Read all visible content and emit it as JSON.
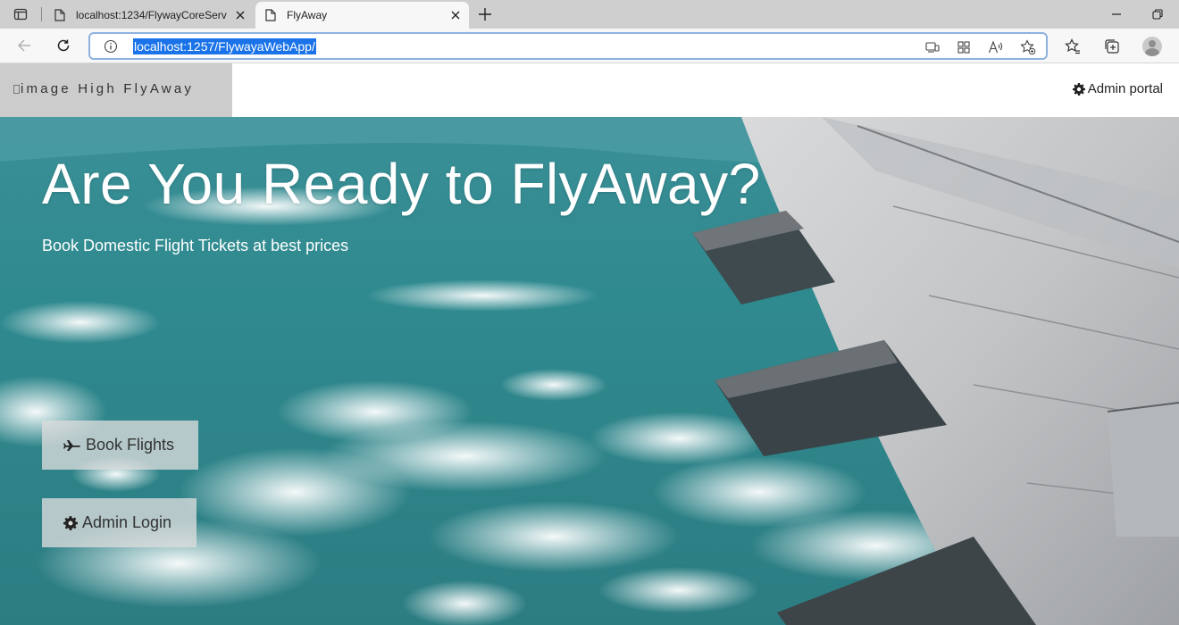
{
  "browser": {
    "tabs": [
      {
        "title": "localhost:1234/FlywayCoreServ",
        "active": false
      },
      {
        "title": "FlyAway",
        "active": true
      }
    ],
    "url": "localhost:1257/FlywayaWebApp/"
  },
  "site": {
    "brand_alt": "image",
    "brand_name": "High FlyAway",
    "admin_portal_label": "Admin portal"
  },
  "hero": {
    "title": "Are You Ready to FlyAway?",
    "subtitle": "Book Domestic Flight Tickets at best prices",
    "book_flights_label": "Book Flights",
    "admin_login_label": "Admin Login"
  },
  "colors": {
    "brand_box": "#cccccc",
    "sky_teal": "#2f8a8f",
    "url_highlight": "#1a73e8",
    "button_bg": "#dcdcdc"
  }
}
